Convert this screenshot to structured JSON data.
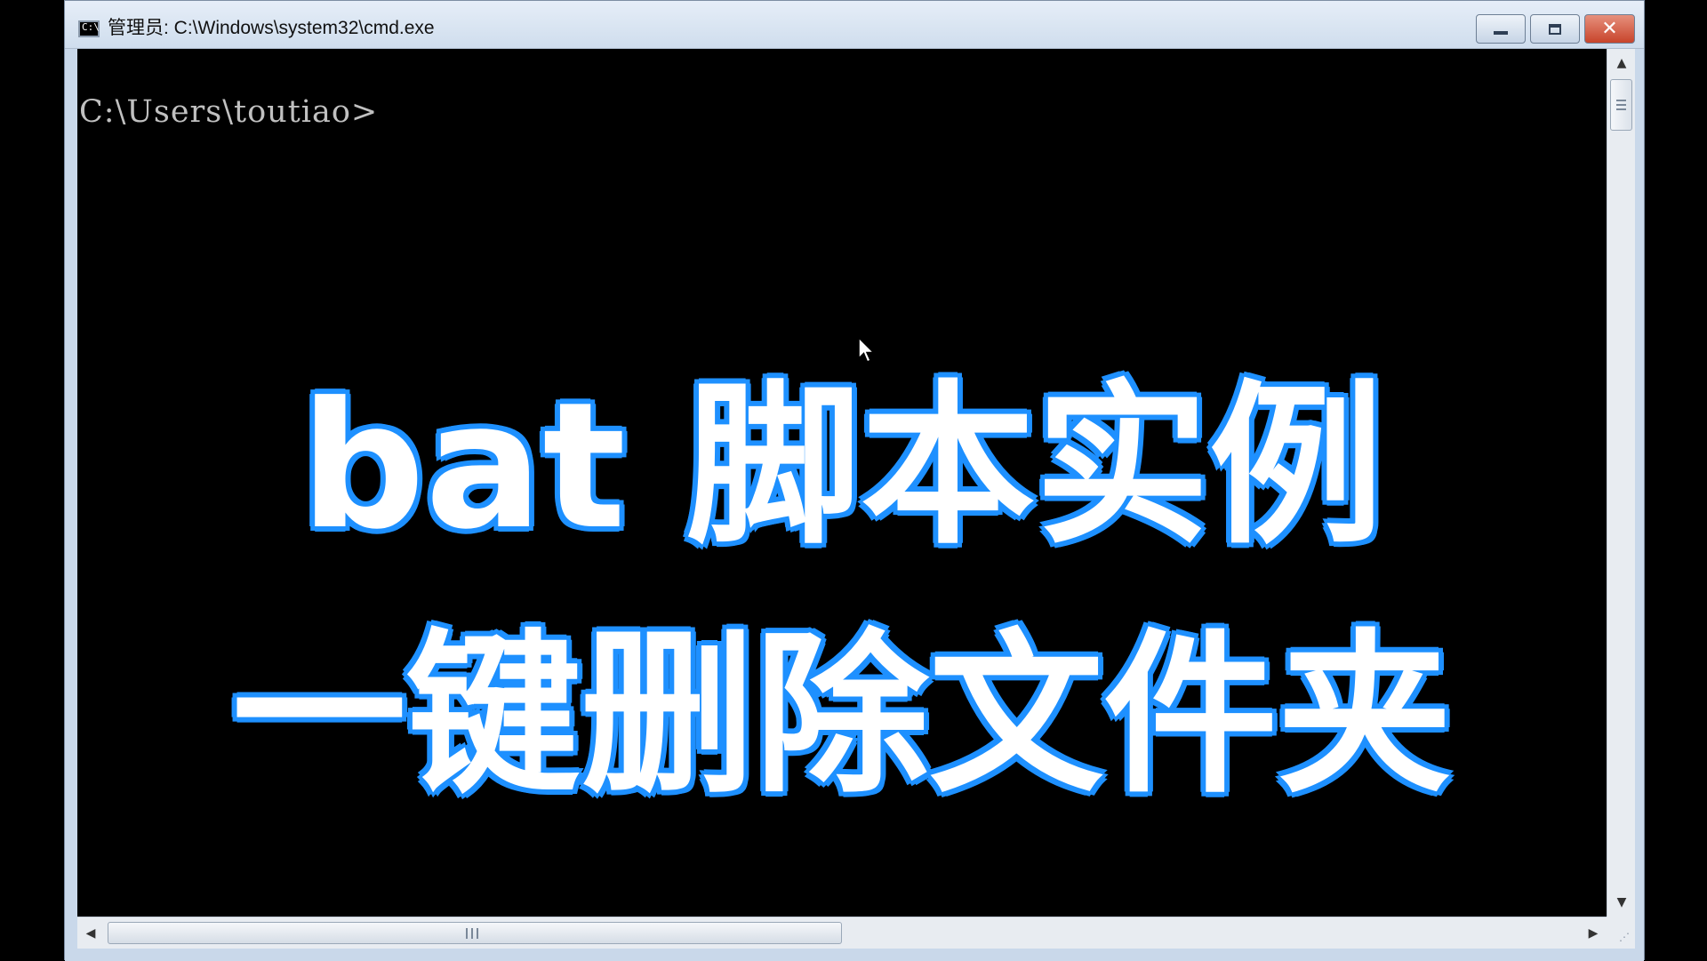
{
  "window": {
    "title": "管理员: C:\\Windows\\system32\\cmd.exe",
    "icon": "cmd-console-icon",
    "icon_prompt": "C:\\",
    "controls": {
      "minimize_icon": "minimize-icon",
      "maximize_icon": "maximize-icon",
      "close_icon": "close-icon",
      "close_glyph": "✕"
    }
  },
  "console": {
    "prompt": "C:\\Users\\toutiao>",
    "colors": {
      "background": "#000000",
      "text": "#c0c0c0"
    }
  },
  "overlay": {
    "line1": "bat 脚本实例",
    "line2": "一键删除文件夹",
    "fill_color": "#ffffff",
    "outline_color": "#1e90ff"
  },
  "scrollbars": {
    "vertical_up_glyph": "▲",
    "vertical_down_glyph": "▼",
    "horizontal_left_glyph": "◀",
    "horizontal_right_glyph": "▶",
    "size_grip_glyph": "⋰"
  }
}
